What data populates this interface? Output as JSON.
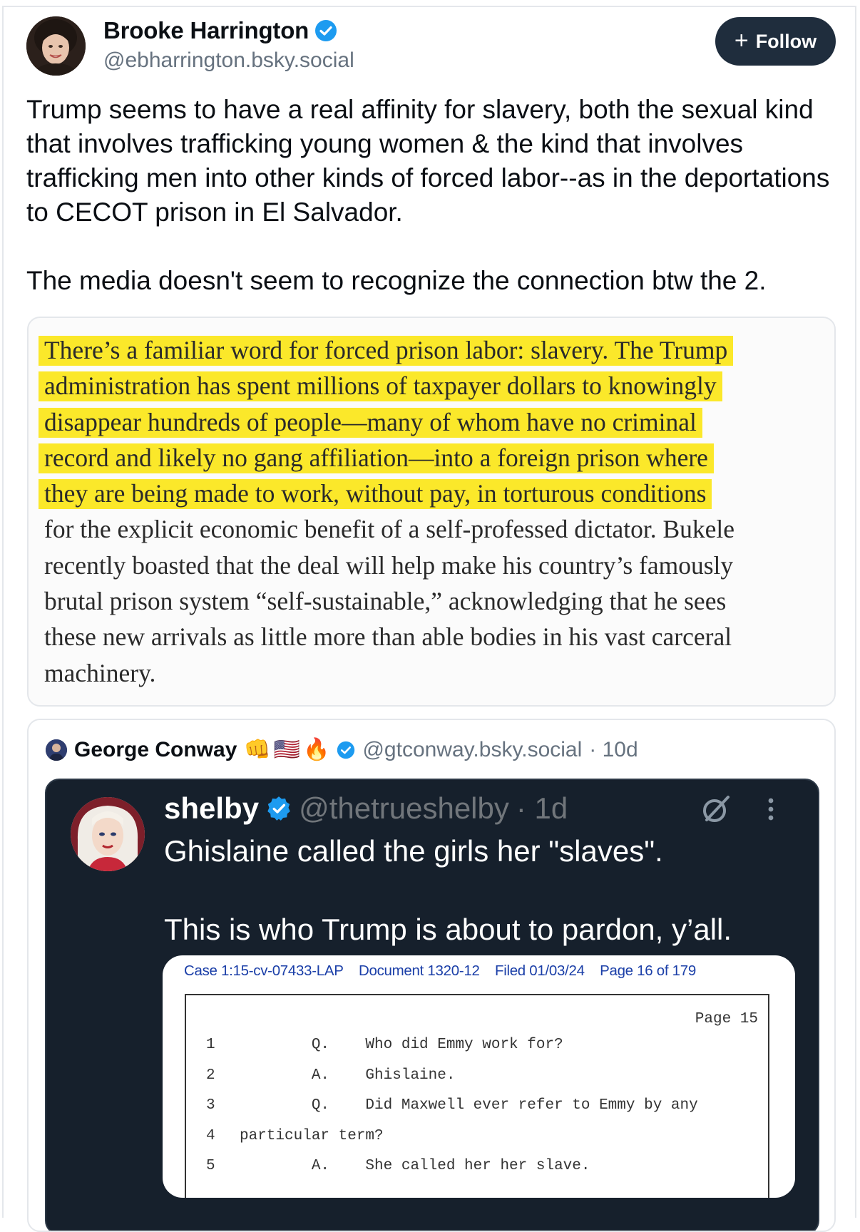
{
  "post": {
    "author_name": "Brooke Harrington",
    "author_handle": "@ebharrington.bsky.social",
    "follow_label": "Follow",
    "paragraphs": [
      "Trump seems to have a real affinity for slavery, both the sexual kind that involves trafficking young women & the kind that involves trafficking men into other kinds of forced labor--as in the deportations to CECOT prison in El Salvador.",
      "The media doesn't seem to recognize the connection btw the 2."
    ]
  },
  "excerpt": {
    "lines": [
      "There’s a familiar word for forced prison labor: slavery. The Trump",
      "administration has spent millions of taxpayer dollars to knowingly",
      "disappear hundreds of people—many of whom have no criminal",
      "record and likely no gang affiliation—into a foreign prison where",
      "they are being made to work, without pay, in torturous conditions",
      "for the explicit economic benefit of a self-professed dictator. Bukele",
      "recently boasted that the deal will help make his country’s famously",
      "brutal prison system “self-sustainable,” acknowledging that he sees",
      "these new arrivals as little more than able bodies in his vast carceral",
      "machinery."
    ],
    "highlighted_line_count": 5
  },
  "quote": {
    "author_name": "George Conway",
    "emoji": [
      "👊",
      "🇺🇸",
      "🔥"
    ],
    "author_handle": "@gtconway.bsky.social",
    "age": "· 10d"
  },
  "embedded_tweet": {
    "name": "shelby",
    "handle": "@thetrueshelby",
    "age": "· 1d",
    "paragraphs": [
      "Ghislaine called the girls her \"slaves\".",
      "This is who Trump is about to pardon, y’all."
    ],
    "document": {
      "header": [
        "Case 1:15-cv-07433-LAP",
        "Document 1320-12",
        "Filed 01/03/24",
        "Page 16 of 179"
      ],
      "page_number": "Page 15",
      "lines": [
        {
          "n": "1",
          "text": "        Q.    Who did Emmy work for?"
        },
        {
          "n": "2",
          "text": "        A.    Ghislaine."
        },
        {
          "n": "3",
          "text": "        Q.    Did Maxwell ever refer to Emmy by any"
        },
        {
          "n": "4",
          "text": "particular term?"
        },
        {
          "n": "5",
          "text": "        A.    She called her her slave."
        }
      ]
    }
  },
  "colors": {
    "follow_bg": "#1f2d3d",
    "verified_blue": "#1d9bf0",
    "highlight_yellow": "#fbe82a",
    "tweet_bg": "#16202c",
    "doc_header_blue": "#1b3fa8"
  }
}
